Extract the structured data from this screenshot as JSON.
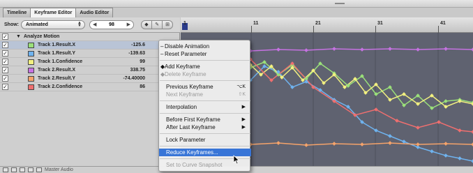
{
  "tabs": [
    {
      "label": "Timeline"
    },
    {
      "label": "Keyframe Editor"
    },
    {
      "label": "Audio Editor"
    }
  ],
  "toolbar": {
    "show_label": "Show:",
    "show_value": "Animated",
    "frame_value": "98"
  },
  "params": {
    "group_title": "Analyze Motion",
    "rows": [
      {
        "name": "Track 1.Result.X",
        "value": "-125.6",
        "color": "#9ae07a"
      },
      {
        "name": "Track 1.Result.Y",
        "value": "-139.63",
        "color": "#6fb3ef"
      },
      {
        "name": "Track 1.Confidence",
        "value": "99",
        "color": "#f2f080"
      },
      {
        "name": "Track 2.Result.X",
        "value": "338.75",
        "color": "#c672e2"
      },
      {
        "name": "Track 2.Result.Y",
        "value": "-74.40000",
        "color": "#f5a36a"
      },
      {
        "name": "Track 2.Confidence",
        "value": "86",
        "color": "#ef6f6f"
      }
    ]
  },
  "ruler": {
    "labels": [
      "1",
      "11",
      "21",
      "31",
      "41"
    ]
  },
  "status": {
    "audio_label": "Master Audio"
  },
  "context_menu": {
    "items": [
      {
        "label": "Disable Animation",
        "disabled": false,
        "prefix": "–"
      },
      {
        "label": "Reset Parameter",
        "disabled": false,
        "prefix": "–"
      },
      {
        "label": "Add Keyframe",
        "disabled": false,
        "prefix": "◆"
      },
      {
        "label": "Delete Keyframe",
        "disabled": true,
        "prefix": "◆"
      },
      {
        "label": "Previous Keyframe",
        "disabled": false,
        "shortcut": "⌥K"
      },
      {
        "label": "Next Keyframe",
        "disabled": true,
        "shortcut": "⇧K"
      },
      {
        "label": "Interpolation",
        "disabled": false,
        "submenu": true
      },
      {
        "label": "Before First Keyframe",
        "disabled": false,
        "submenu": true
      },
      {
        "label": "After Last Keyframe",
        "disabled": false,
        "submenu": true
      },
      {
        "label": "Lock Parameter",
        "disabled": false
      },
      {
        "label": "Reduce Keyframes...",
        "disabled": false,
        "highlighted": true
      },
      {
        "label": "Set to Curve Snapshot",
        "disabled": true
      }
    ]
  },
  "colors": {
    "track1_x": "#9ae07a",
    "track1_y": "#6fb3ef",
    "track1_conf": "#f2f080",
    "track2_x": "#c672e2",
    "track2_y": "#f5a36a",
    "track2_conf": "#ef6f6f",
    "graph_bg": "#5f6270",
    "menu_highlight": "#3875d7"
  }
}
